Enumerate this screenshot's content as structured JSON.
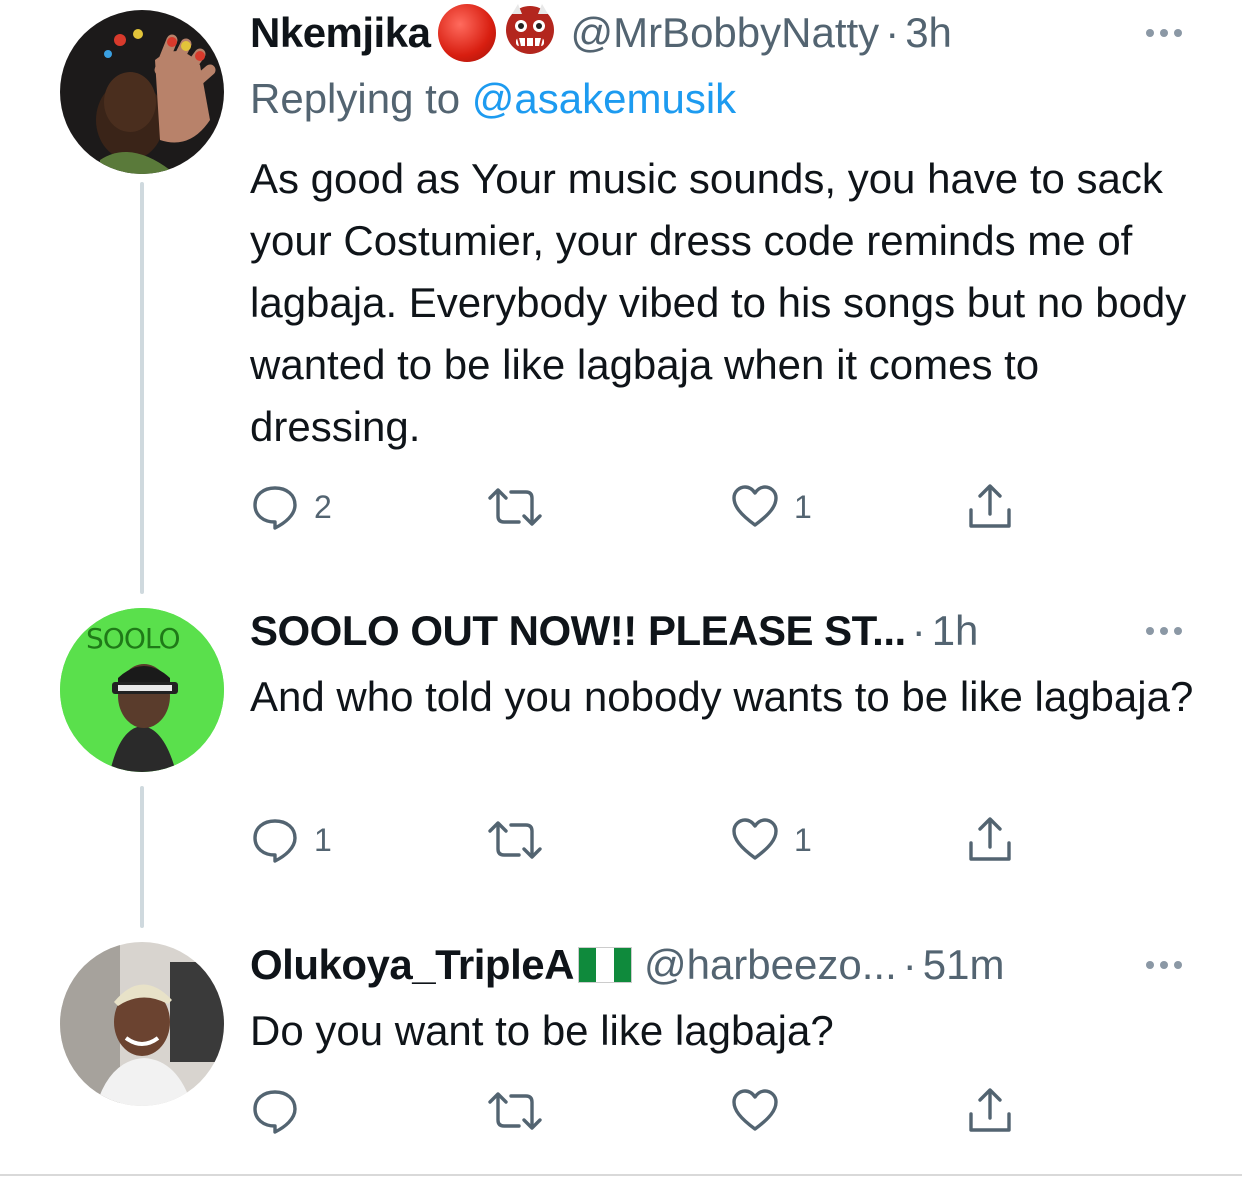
{
  "tweets": [
    {
      "display_name": "Nkemjika",
      "handle": "@MrBobbyNatty",
      "time": "3h",
      "replying_prefix": "Replying to ",
      "replying_to": "@asakemusik",
      "text": "As good as Your music sounds, you have to sack your Costumier, your dress code reminds me of lagbaja. Everybody vibed to his songs but no body wanted to be like lagbaja when it comes to dressing.",
      "reply_count": "2",
      "retweet_count": "",
      "like_count": "1",
      "emojis": [
        "red-circle-emoji",
        "ogre-mask-emoji"
      ]
    },
    {
      "display_name": "SOOLO OUT NOW!! PLEASE ST...",
      "avatar_text": "SOOLO",
      "time": "1h",
      "text": "And who told you nobody wants to be like lagbaja?",
      "reply_count": "1",
      "retweet_count": "",
      "like_count": "1"
    },
    {
      "display_name": "Olukoya_TripleA",
      "handle": "@harbeezo...",
      "time": "51m",
      "text": "Do you want to be like lagbaja?",
      "reply_count": "",
      "retweet_count": "",
      "like_count": "",
      "emojis": [
        "nigeria-flag-emoji"
      ]
    }
  ],
  "separator": "·",
  "colors": {
    "text": "#0f1419",
    "secondary": "#536471",
    "link": "#1d9bf0",
    "thread_line": "#cfd9de",
    "soolo_green": "#5ae04c",
    "flag_green": "#0f8a3c"
  }
}
